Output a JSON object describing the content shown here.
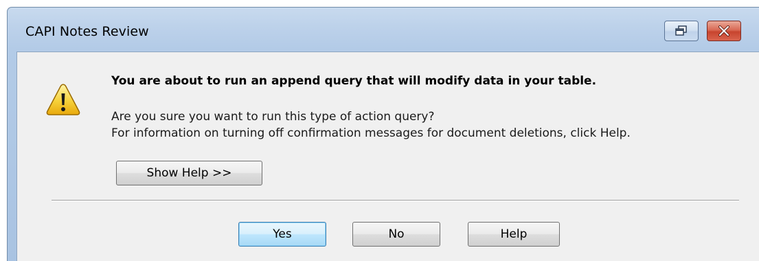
{
  "window": {
    "title": "CAPI Notes Review",
    "restore_icon": "restore-icon",
    "close_icon": "close-icon",
    "close_glyph": "✕"
  },
  "dialog": {
    "icon": "warning-icon",
    "heading": "You are about to run an append query that will modify data in your table.",
    "message_line1": "Are you sure you want to run this type of action query?",
    "message_line2": "For information on turning off confirmation messages for document deletions, click Help.",
    "show_help_label": "Show Help >>"
  },
  "buttons": {
    "yes_label": "Yes",
    "no_label": "No",
    "help_label": "Help"
  },
  "colors": {
    "titlebar": "#bcd1ea",
    "client": "#f0f0f0",
    "close_button": "#c7442e",
    "default_button_border": "#3c7fb1",
    "warning_yellow": "#f2c318"
  }
}
